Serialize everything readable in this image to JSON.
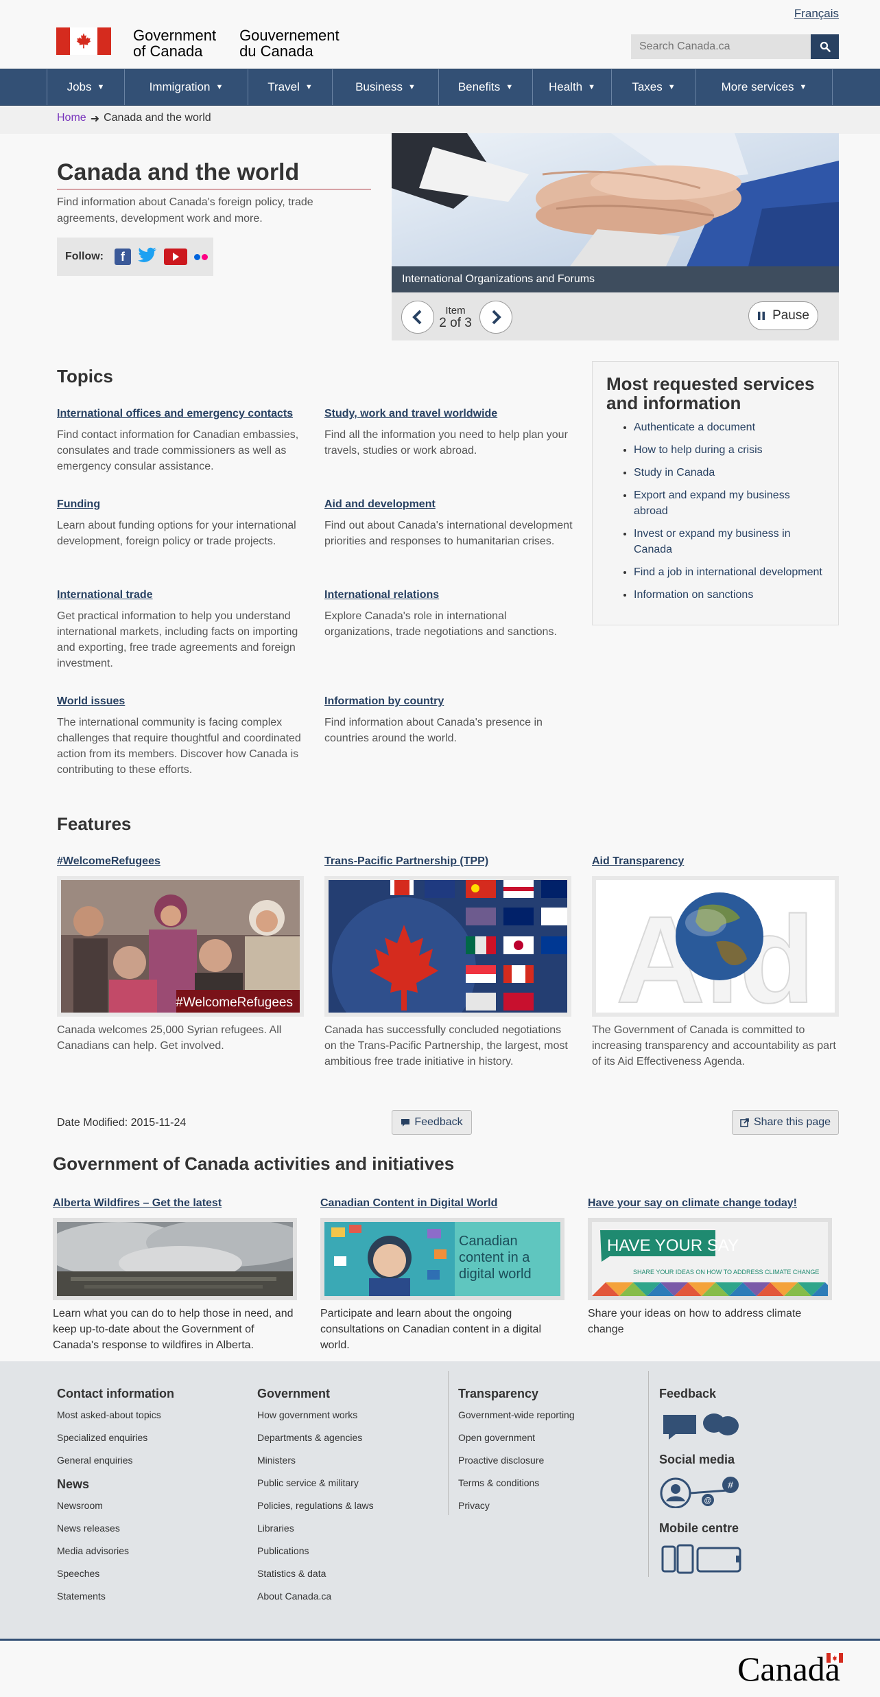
{
  "header": {
    "lang_toggle": "Français",
    "fip_en_line1": "Government",
    "fip_en_line2": "of Canada",
    "fip_fr_line1": "Gouvernement",
    "fip_fr_line2": "du Canada",
    "search_placeholder": "Search Canada.ca"
  },
  "menu": [
    "Jobs",
    "Immigration",
    "Travel",
    "Business",
    "Benefits",
    "Health",
    "Taxes",
    "More services"
  ],
  "breadcrumb": {
    "home": "Home",
    "arrow": "➜",
    "current": "Canada and the world"
  },
  "intro": {
    "title": "Canada and the world",
    "text": "Find information about Canada's foreign policy, trade agreements, development work and more.",
    "follow_label": "Follow:"
  },
  "carousel": {
    "caption": "International Organizations and Forums",
    "item_label": "Item",
    "item_count": "2 of 3",
    "pause_label": "Pause"
  },
  "topics": {
    "heading": "Topics",
    "items": [
      {
        "title": "International offices and emergency contacts",
        "text": "Find contact information for Canadian embassies, consulates and trade commissioners as well as emergency consular assistance."
      },
      {
        "title": "Study, work and travel worldwide",
        "text": "Find all the information you need to help plan your travels, studies or work abroad."
      },
      {
        "title": "Funding",
        "text": "Learn about funding options for your international development, foreign policy or trade projects."
      },
      {
        "title": "Aid and development",
        "text": "Find out about Canada's international development priorities and responses to humanitarian crises."
      },
      {
        "title": "International trade",
        "text": "Get practical information to help you understand international markets, including facts on importing and exporting, free trade agreements and foreign investment."
      },
      {
        "title": "International relations",
        "text": "Explore Canada's role in international organizations, trade negotiations and sanctions."
      },
      {
        "title": "World issues",
        "text": "The international community is facing complex challenges that require thoughtful and coordinated action from its members. Discover how Canada is contributing to these efforts."
      },
      {
        "title": "Information by country",
        "text": "Find information about Canada's presence in countries around the world."
      }
    ]
  },
  "most_requested": {
    "heading": "Most requested services and information",
    "links": [
      "Authenticate a document",
      "How to help during a crisis",
      "Study in Canada",
      "Export and expand my business abroad",
      "Invest or expand my business in Canada",
      "Find a job in international development",
      "Information on sanctions"
    ]
  },
  "features": {
    "heading": "Features",
    "items": [
      {
        "title": "#WelcomeRefugees",
        "img_text": "#WelcomeRefugees",
        "text": "Canada welcomes 25,000 Syrian refugees. All Canadians can help. Get involved."
      },
      {
        "title": "Trans-Pacific Partnership (TPP)",
        "text": "Canada has successfully concluded negotiations on the Trans-Pacific Partnership, the largest, most ambitious free trade initiative in history."
      },
      {
        "title": "Aid Transparency",
        "img_text": "Aid",
        "text": "The Government of Canada is committed to increasing transparency and accountability as part of its Aid Effectiveness Agenda."
      }
    ]
  },
  "page_details": {
    "date_modified": "Date Modified: 2015-11-24",
    "feedback": "Feedback",
    "share": "Share this page"
  },
  "activities": {
    "heading": "Government of Canada activities and initiatives",
    "items": [
      {
        "title": "Alberta Wildfires – Get the latest",
        "text": "Learn what you can do to help those in need, and keep up-to-date about the Government of Canada's response to wildfires in Alberta."
      },
      {
        "title": "Canadian Content in Digital World",
        "img_text": "Canadian content in a digital world",
        "text": "Participate and learn about the ongoing consultations on Canadian content in a digital world."
      },
      {
        "title": "Have your say on climate change today!",
        "img_text": "HAVE YOUR SAY",
        "img_subtext": "SHARE YOUR IDEAS ON HOW TO ADDRESS CLIMATE CHANGE",
        "text": "Share your ideas on how to address climate change"
      }
    ]
  },
  "footer": {
    "contact_heading": "Contact information",
    "contact_links": [
      "Most asked-about topics",
      "Specialized enquiries",
      "General enquiries"
    ],
    "news_heading": "News",
    "news_links": [
      "Newsroom",
      "News releases",
      "Media advisories",
      "Speeches",
      "Statements"
    ],
    "gov_heading": "Government",
    "gov_links": [
      "How government works",
      "Departments & agencies",
      "Ministers",
      "Public service & military",
      "Policies, regulations & laws",
      "Libraries",
      "Publications",
      "Statistics & data",
      "About Canada.ca"
    ],
    "transparency_heading": "Transparency",
    "transparency_links": [
      "Government-wide reporting",
      "Open government",
      "Proactive disclosure",
      "Terms & conditions",
      "Privacy"
    ],
    "feedback_heading": "Feedback",
    "social_heading": "Social media",
    "mobile_heading": "Mobile centre",
    "wordmark": "Canada"
  },
  "colors": {
    "brand_blue": "#335075",
    "link": "#284162",
    "red": "#d52b1e"
  }
}
